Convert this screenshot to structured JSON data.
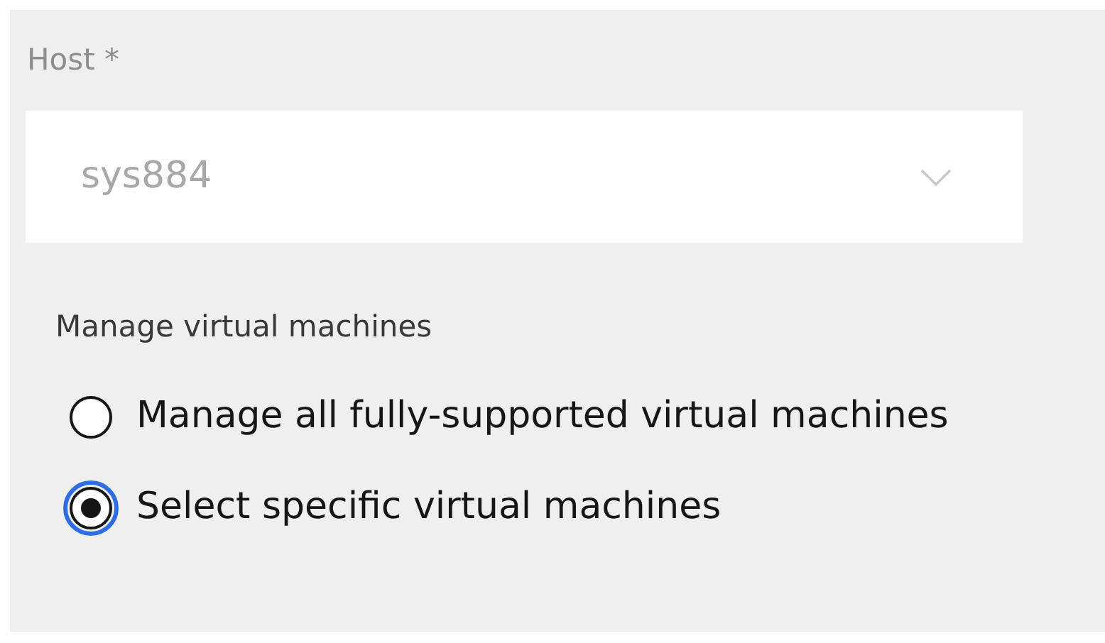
{
  "host_field": {
    "label": "Host *",
    "value": "sys884",
    "disabled": true
  },
  "manage_group": {
    "legend": "Manage virtual machines",
    "options": [
      {
        "label": "Manage all fully-supported virtual machines",
        "selected": false
      },
      {
        "label": "Select specific virtual machines",
        "selected": true
      }
    ]
  }
}
